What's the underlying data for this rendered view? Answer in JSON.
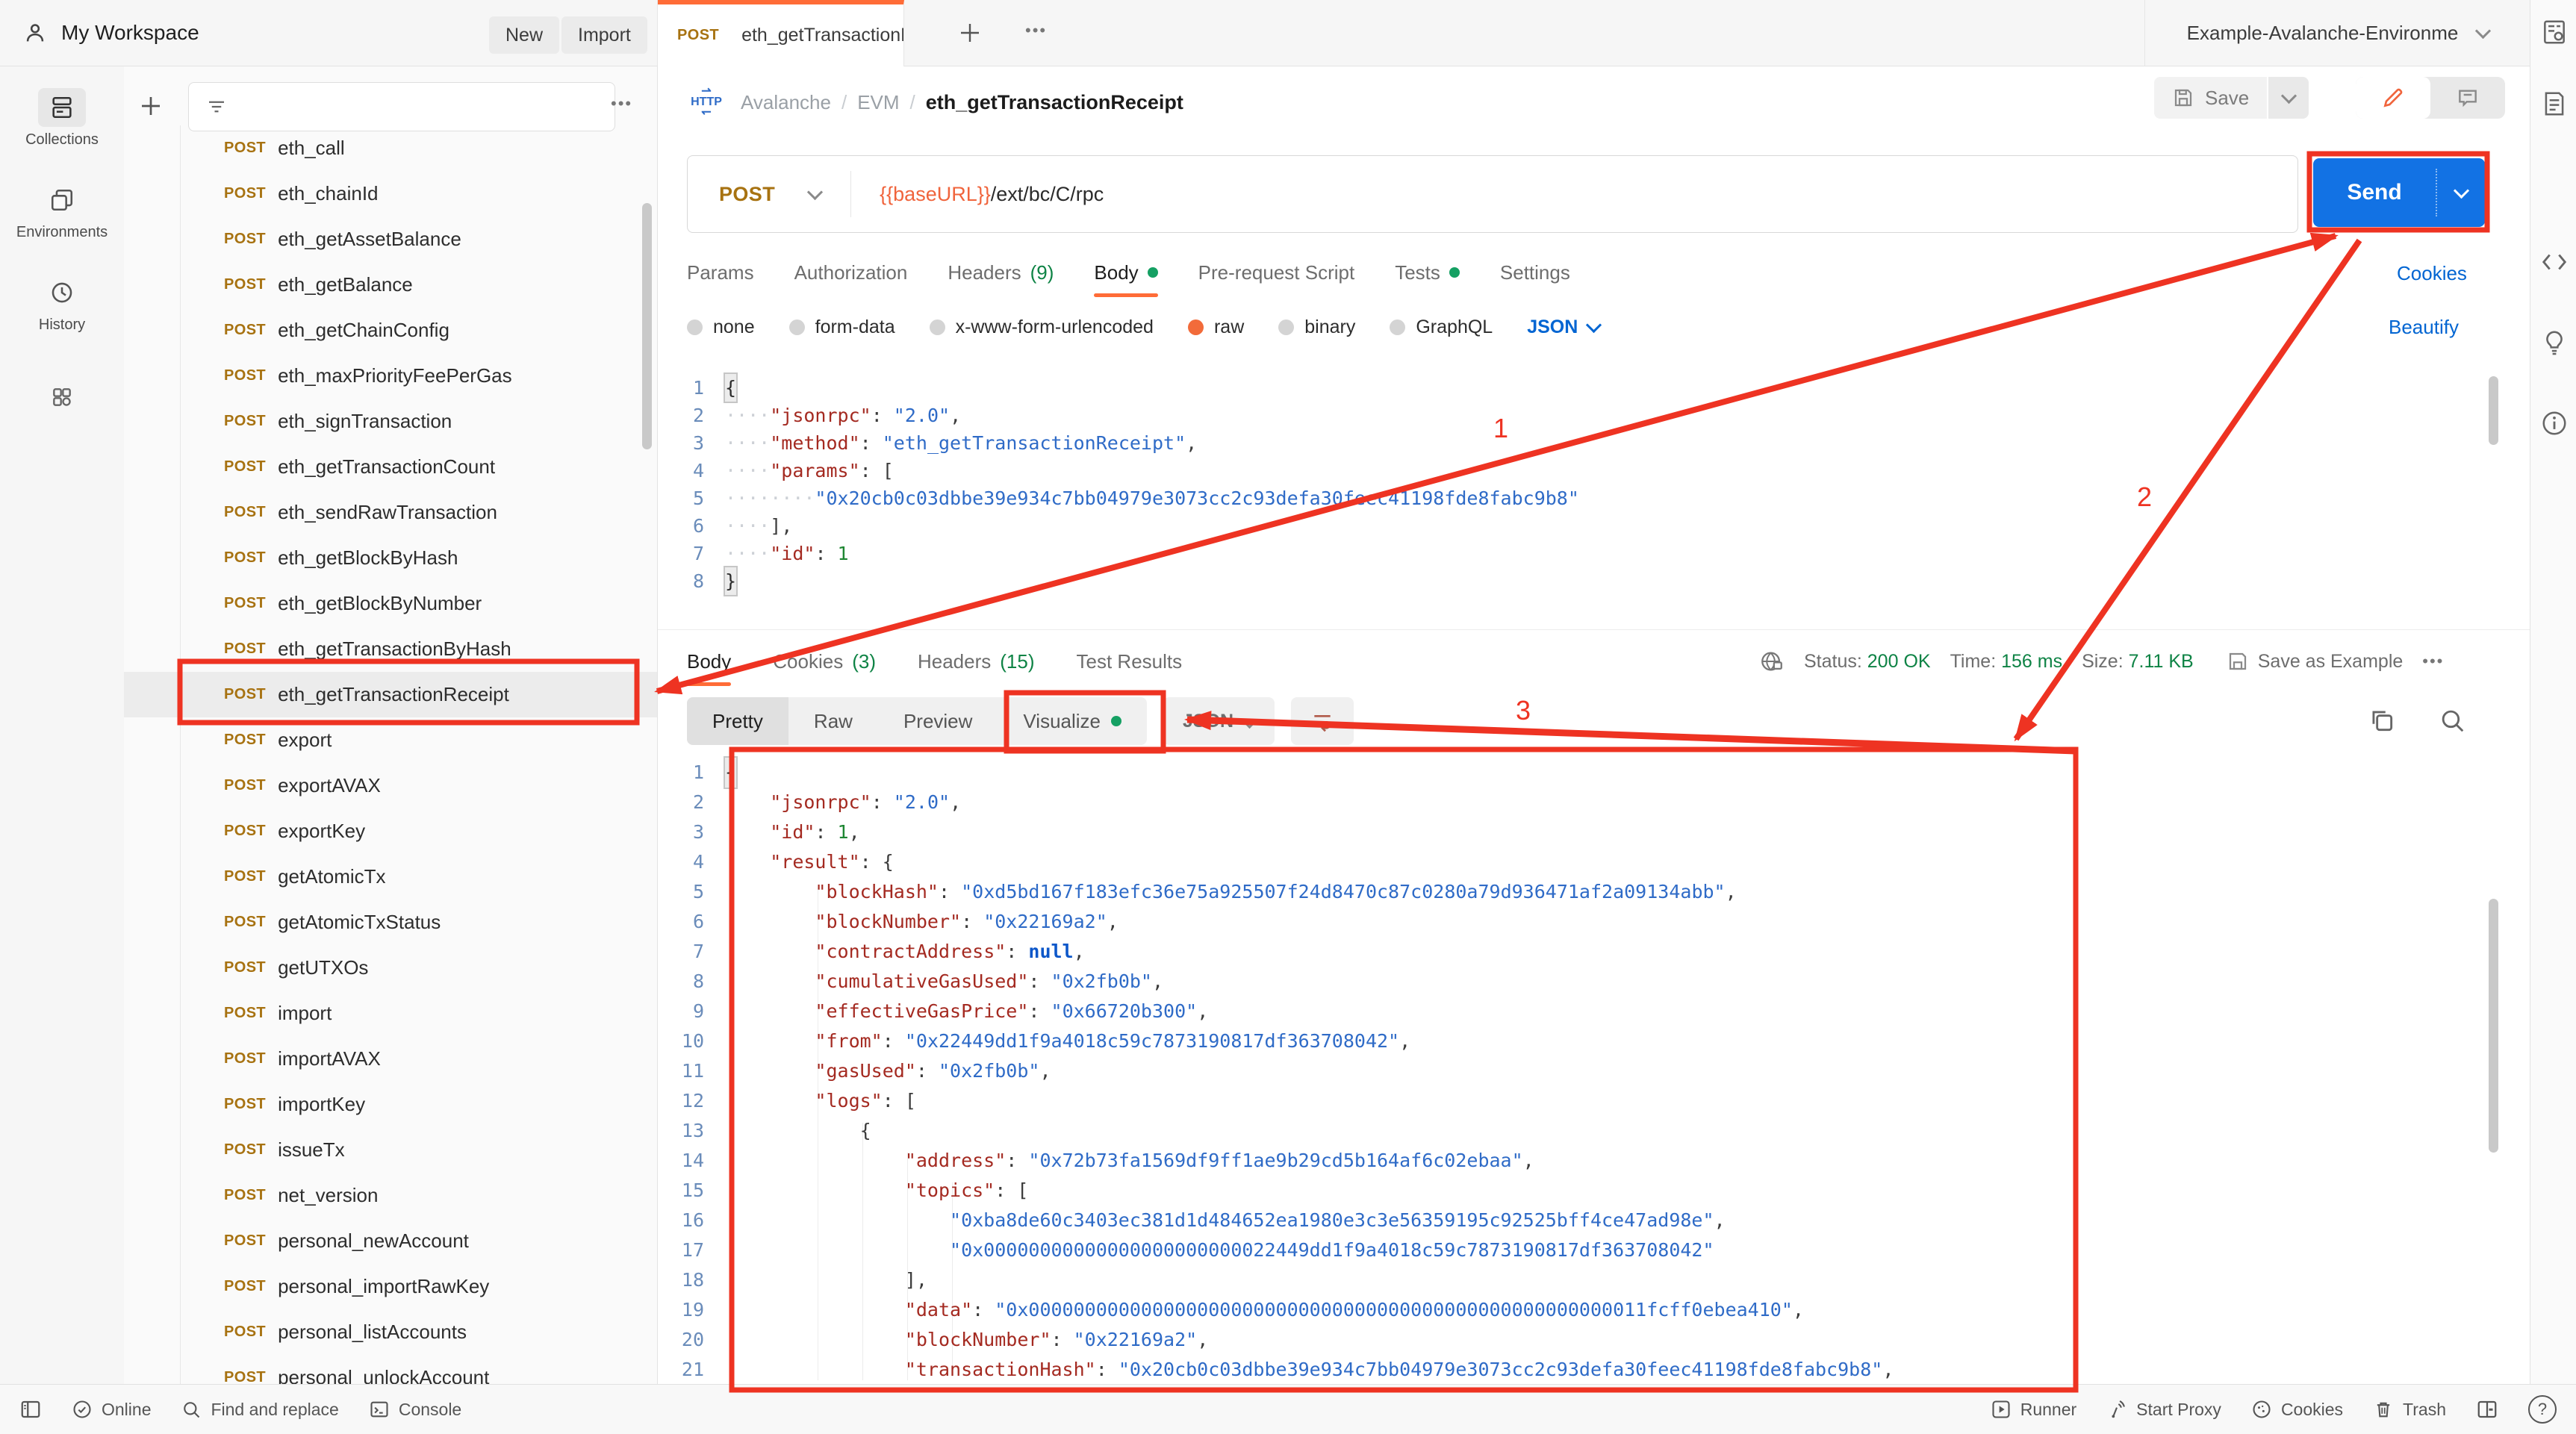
{
  "header": {
    "workspace": "My Workspace",
    "new_button": "New",
    "import_button": "Import",
    "tab": {
      "method": "POST",
      "title": "eth_getTransactionRece"
    },
    "environment": "Example-Avalanche-Environme"
  },
  "rail": {
    "items": [
      {
        "label": "Collections"
      },
      {
        "label": "Environments"
      },
      {
        "label": "History"
      }
    ]
  },
  "sidebar": {
    "items": [
      {
        "method": "POST",
        "name": "eth_call"
      },
      {
        "method": "POST",
        "name": "eth_chainId"
      },
      {
        "method": "POST",
        "name": "eth_getAssetBalance"
      },
      {
        "method": "POST",
        "name": "eth_getBalance"
      },
      {
        "method": "POST",
        "name": "eth_getChainConfig"
      },
      {
        "method": "POST",
        "name": "eth_maxPriorityFeePerGas"
      },
      {
        "method": "POST",
        "name": "eth_signTransaction"
      },
      {
        "method": "POST",
        "name": "eth_getTransactionCount"
      },
      {
        "method": "POST",
        "name": "eth_sendRawTransaction"
      },
      {
        "method": "POST",
        "name": "eth_getBlockByHash"
      },
      {
        "method": "POST",
        "name": "eth_getBlockByNumber"
      },
      {
        "method": "POST",
        "name": "eth_getTransactionByHash"
      },
      {
        "method": "POST",
        "name": "eth_getTransactionReceipt",
        "selected": true
      },
      {
        "method": "POST",
        "name": "export"
      },
      {
        "method": "POST",
        "name": "exportAVAX"
      },
      {
        "method": "POST",
        "name": "exportKey"
      },
      {
        "method": "POST",
        "name": "getAtomicTx"
      },
      {
        "method": "POST",
        "name": "getAtomicTxStatus"
      },
      {
        "method": "POST",
        "name": "getUTXOs"
      },
      {
        "method": "POST",
        "name": "import"
      },
      {
        "method": "POST",
        "name": "importAVAX"
      },
      {
        "method": "POST",
        "name": "importKey"
      },
      {
        "method": "POST",
        "name": "issueTx"
      },
      {
        "method": "POST",
        "name": "net_version"
      },
      {
        "method": "POST",
        "name": "personal_newAccount"
      },
      {
        "method": "POST",
        "name": "personal_importRawKey"
      },
      {
        "method": "POST",
        "name": "personal_listAccounts"
      },
      {
        "method": "POST",
        "name": "personal_unlockAccount"
      }
    ]
  },
  "request": {
    "breadcrumb": [
      "Avalanche",
      "EVM",
      "eth_getTransactionReceipt"
    ],
    "save_label": "Save",
    "method": "POST",
    "url_var": "{{baseURL}}",
    "url_path": "/ext/bc/C/rpc",
    "send_label": "Send",
    "tabs": [
      {
        "label": "Params"
      },
      {
        "label": "Authorization"
      },
      {
        "label": "Headers",
        "count": "(9)"
      },
      {
        "label": "Body",
        "dot": true,
        "active": true
      },
      {
        "label": "Pre-request Script"
      },
      {
        "label": "Tests",
        "dot": true
      },
      {
        "label": "Settings"
      }
    ],
    "cookies_link": "Cookies",
    "beautify_link": "Beautify",
    "body_modes": [
      {
        "label": "none"
      },
      {
        "label": "form-data"
      },
      {
        "label": "x-www-form-urlencoded"
      },
      {
        "label": "raw",
        "on": true
      },
      {
        "label": "binary"
      },
      {
        "label": "GraphQL"
      }
    ],
    "lang": "JSON",
    "code": [
      [
        [
          "m",
          "{"
        ]
      ],
      [
        [
          "w",
          "····"
        ],
        [
          "k",
          "\"jsonrpc\""
        ],
        [
          "p",
          ": "
        ],
        [
          "s",
          "\"2.0\""
        ],
        [
          "p",
          ","
        ]
      ],
      [
        [
          "w",
          "····"
        ],
        [
          "k",
          "\"method\""
        ],
        [
          "p",
          ": "
        ],
        [
          "s",
          "\"eth_getTransactionReceipt\""
        ],
        [
          "p",
          ","
        ]
      ],
      [
        [
          "w",
          "····"
        ],
        [
          "k",
          "\"params\""
        ],
        [
          "p",
          ": ["
        ]
      ],
      [
        [
          "w",
          "········"
        ],
        [
          "s",
          "\"0x20cb0c03dbbe39e934c7bb04979e3073cc2c93defa30feec41198fde8fabc9b8\""
        ]
      ],
      [
        [
          "w",
          "····"
        ],
        [
          "p",
          "],"
        ]
      ],
      [
        [
          "w",
          "····"
        ],
        [
          "k",
          "\"id\""
        ],
        [
          "p",
          ": "
        ],
        [
          "n",
          "1"
        ]
      ],
      [
        [
          "m",
          "}"
        ]
      ]
    ]
  },
  "response": {
    "tabs": [
      {
        "label": "Body",
        "active": true
      },
      {
        "label": "Cookies",
        "count": "(3)"
      },
      {
        "label": "Headers",
        "count": "(15)"
      },
      {
        "label": "Test Results"
      }
    ],
    "status_label": "Status:",
    "status_value": "200 OK",
    "time_label": "Time:",
    "time_value": "156 ms",
    "size_label": "Size:",
    "size_value": "7.11 KB",
    "save_example": "Save as Example",
    "views": [
      {
        "label": "Pretty",
        "active": true
      },
      {
        "label": "Raw"
      },
      {
        "label": "Preview"
      },
      {
        "label": "Visualize",
        "dot": true
      }
    ],
    "lang": "JSON",
    "code": [
      [
        [
          "m",
          "{"
        ]
      ],
      [
        [
          "p",
          "    "
        ],
        [
          "k",
          "\"jsonrpc\""
        ],
        [
          "p",
          ": "
        ],
        [
          "s",
          "\"2.0\""
        ],
        [
          "p",
          ","
        ]
      ],
      [
        [
          "p",
          "    "
        ],
        [
          "k",
          "\"id\""
        ],
        [
          "p",
          ": "
        ],
        [
          "n",
          "1"
        ],
        [
          "p",
          ","
        ]
      ],
      [
        [
          "p",
          "    "
        ],
        [
          "k",
          "\"result\""
        ],
        [
          "p",
          ": {"
        ]
      ],
      [
        [
          "p",
          "        "
        ],
        [
          "k",
          "\"blockHash\""
        ],
        [
          "p",
          ": "
        ],
        [
          "s",
          "\"0xd5bd167f183efc36e75a925507f24d8470c87c0280a79d936471af2a09134abb\""
        ],
        [
          "p",
          ","
        ]
      ],
      [
        [
          "p",
          "        "
        ],
        [
          "k",
          "\"blockNumber\""
        ],
        [
          "p",
          ": "
        ],
        [
          "s",
          "\"0x22169a2\""
        ],
        [
          "p",
          ","
        ]
      ],
      [
        [
          "p",
          "        "
        ],
        [
          "k",
          "\"contractAddress\""
        ],
        [
          "p",
          ": "
        ],
        [
          "b",
          "null"
        ],
        [
          "p",
          ","
        ]
      ],
      [
        [
          "p",
          "        "
        ],
        [
          "k",
          "\"cumulativeGasUsed\""
        ],
        [
          "p",
          ": "
        ],
        [
          "s",
          "\"0x2fb0b\""
        ],
        [
          "p",
          ","
        ]
      ],
      [
        [
          "p",
          "        "
        ],
        [
          "k",
          "\"effectiveGasPrice\""
        ],
        [
          "p",
          ": "
        ],
        [
          "s",
          "\"0x66720b300\""
        ],
        [
          "p",
          ","
        ]
      ],
      [
        [
          "p",
          "        "
        ],
        [
          "k",
          "\"from\""
        ],
        [
          "p",
          ": "
        ],
        [
          "s",
          "\"0x22449dd1f9a4018c59c7873190817df363708042\""
        ],
        [
          "p",
          ","
        ]
      ],
      [
        [
          "p",
          "        "
        ],
        [
          "k",
          "\"gasUsed\""
        ],
        [
          "p",
          ": "
        ],
        [
          "s",
          "\"0x2fb0b\""
        ],
        [
          "p",
          ","
        ]
      ],
      [
        [
          "p",
          "        "
        ],
        [
          "k",
          "\"logs\""
        ],
        [
          "p",
          ": ["
        ]
      ],
      [
        [
          "p",
          "            "
        ],
        [
          "p",
          "{"
        ]
      ],
      [
        [
          "p",
          "                "
        ],
        [
          "k",
          "\"address\""
        ],
        [
          "p",
          ": "
        ],
        [
          "s",
          "\"0x72b73fa1569df9ff1ae9b29cd5b164af6c02ebaa\""
        ],
        [
          "p",
          ","
        ]
      ],
      [
        [
          "p",
          "                "
        ],
        [
          "k",
          "\"topics\""
        ],
        [
          "p",
          ": ["
        ]
      ],
      [
        [
          "p",
          "                    "
        ],
        [
          "s",
          "\"0xba8de60c3403ec381d1d484652ea1980e3c3e56359195c92525bff4ce47ad98e\""
        ],
        [
          "p",
          ","
        ]
      ],
      [
        [
          "p",
          "                    "
        ],
        [
          "s",
          "\"0x00000000000000000000000022449dd1f9a4018c59c7873190817df363708042\""
        ]
      ],
      [
        [
          "p",
          "                "
        ],
        [
          "p",
          "],"
        ]
      ],
      [
        [
          "p",
          "                "
        ],
        [
          "k",
          "\"data\""
        ],
        [
          "p",
          ": "
        ],
        [
          "s",
          "\"0x0000000000000000000000000000000000000000000000000000011fcff0ebea410\""
        ],
        [
          "p",
          ","
        ]
      ],
      [
        [
          "p",
          "                "
        ],
        [
          "k",
          "\"blockNumber\""
        ],
        [
          "p",
          ": "
        ],
        [
          "s",
          "\"0x22169a2\""
        ],
        [
          "p",
          ","
        ]
      ],
      [
        [
          "p",
          "                "
        ],
        [
          "k",
          "\"transactionHash\""
        ],
        [
          "p",
          ": "
        ],
        [
          "s",
          "\"0x20cb0c03dbbe39e934c7bb04979e3073cc2c93defa30feec41198fde8fabc9b8\""
        ],
        [
          "p",
          ","
        ]
      ]
    ]
  },
  "statusbar": {
    "online": "Online",
    "find": "Find and replace",
    "console": "Console",
    "runner": "Runner",
    "proxy": "Start Proxy",
    "cookies": "Cookies",
    "trash": "Trash"
  },
  "annotations": {
    "label1": "1",
    "label2": "2",
    "label3": "3",
    "color": "#ee3322"
  },
  "colors": {
    "accent_orange": "#ff6c37",
    "send_blue": "#1272e4",
    "link_blue": "#0265d2",
    "success_green": "#0e8345",
    "method_amber": "#a77211"
  }
}
